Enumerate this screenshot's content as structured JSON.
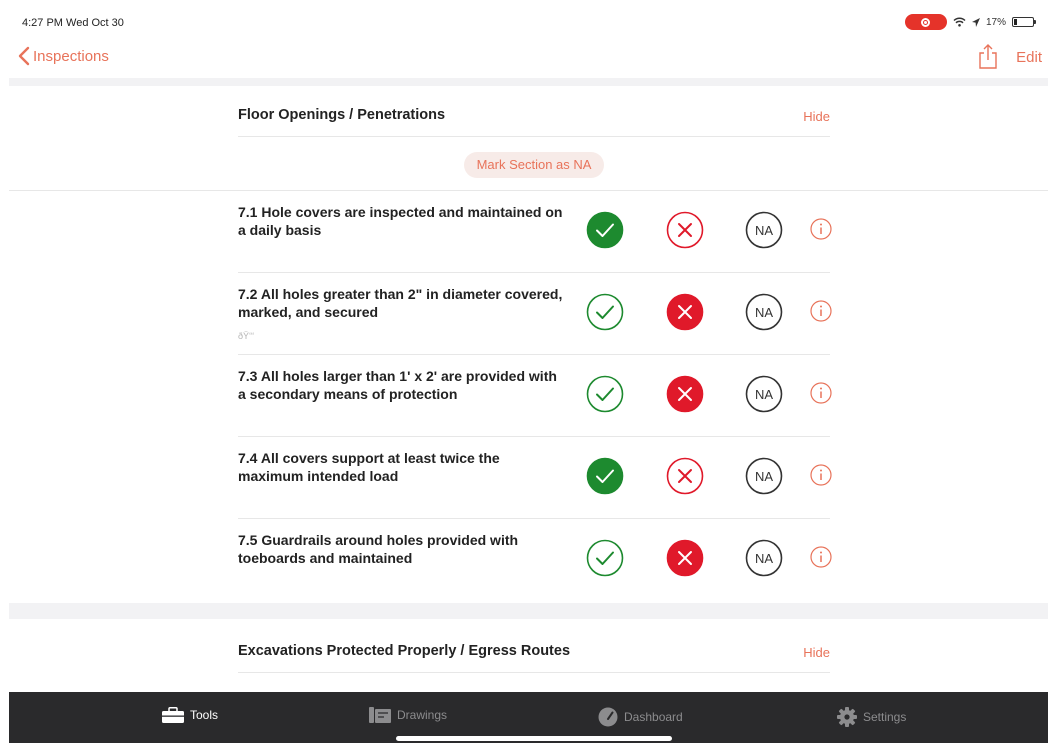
{
  "status": {
    "time": "4:27 PM  Wed Oct 30",
    "battery": "17%",
    "battery_level": 0.17
  },
  "nav": {
    "back_label": "Inspections",
    "edit_label": "Edit"
  },
  "sections": [
    {
      "title": "Floor Openings / Penetrations",
      "hide_label": "Hide",
      "mark_na_label": "Mark Section as NA"
    },
    {
      "title": "Excavations Protected Properly / Egress Routes",
      "hide_label": "Hide"
    }
  ],
  "na_label": "NA",
  "items": [
    {
      "text": "7.1 Hole covers are inspected and maintained on a daily basis",
      "note": "",
      "answer": "yes"
    },
    {
      "text": "7.2 All holes greater than 2\" in diameter covered, marked, and secured",
      "note": "ðŸ‘“",
      "answer": "no"
    },
    {
      "text": "7.3 All holes larger than 1' x 2' are provided with a secondary means of protection",
      "note": "",
      "answer": "no"
    },
    {
      "text": "7.4 All covers support at least twice the maximum intended load",
      "note": "",
      "answer": "yes"
    },
    {
      "text": "7.5 Guardrails around holes provided with toeboards and maintained",
      "note": "",
      "answer": "no"
    }
  ],
  "tabs": [
    {
      "label": "Tools",
      "icon": "toolbox-icon",
      "active": true
    },
    {
      "label": "Drawings",
      "icon": "drawings-icon",
      "active": false
    },
    {
      "label": "Dashboard",
      "icon": "dashboard-icon",
      "active": false
    },
    {
      "label": "Settings",
      "icon": "gear-icon",
      "active": false
    }
  ],
  "colors": {
    "accent": "#e8735a",
    "yes_green": "#1d8a2f",
    "no_red": "#e0192a",
    "tab_bg": "#2a2a2c"
  }
}
